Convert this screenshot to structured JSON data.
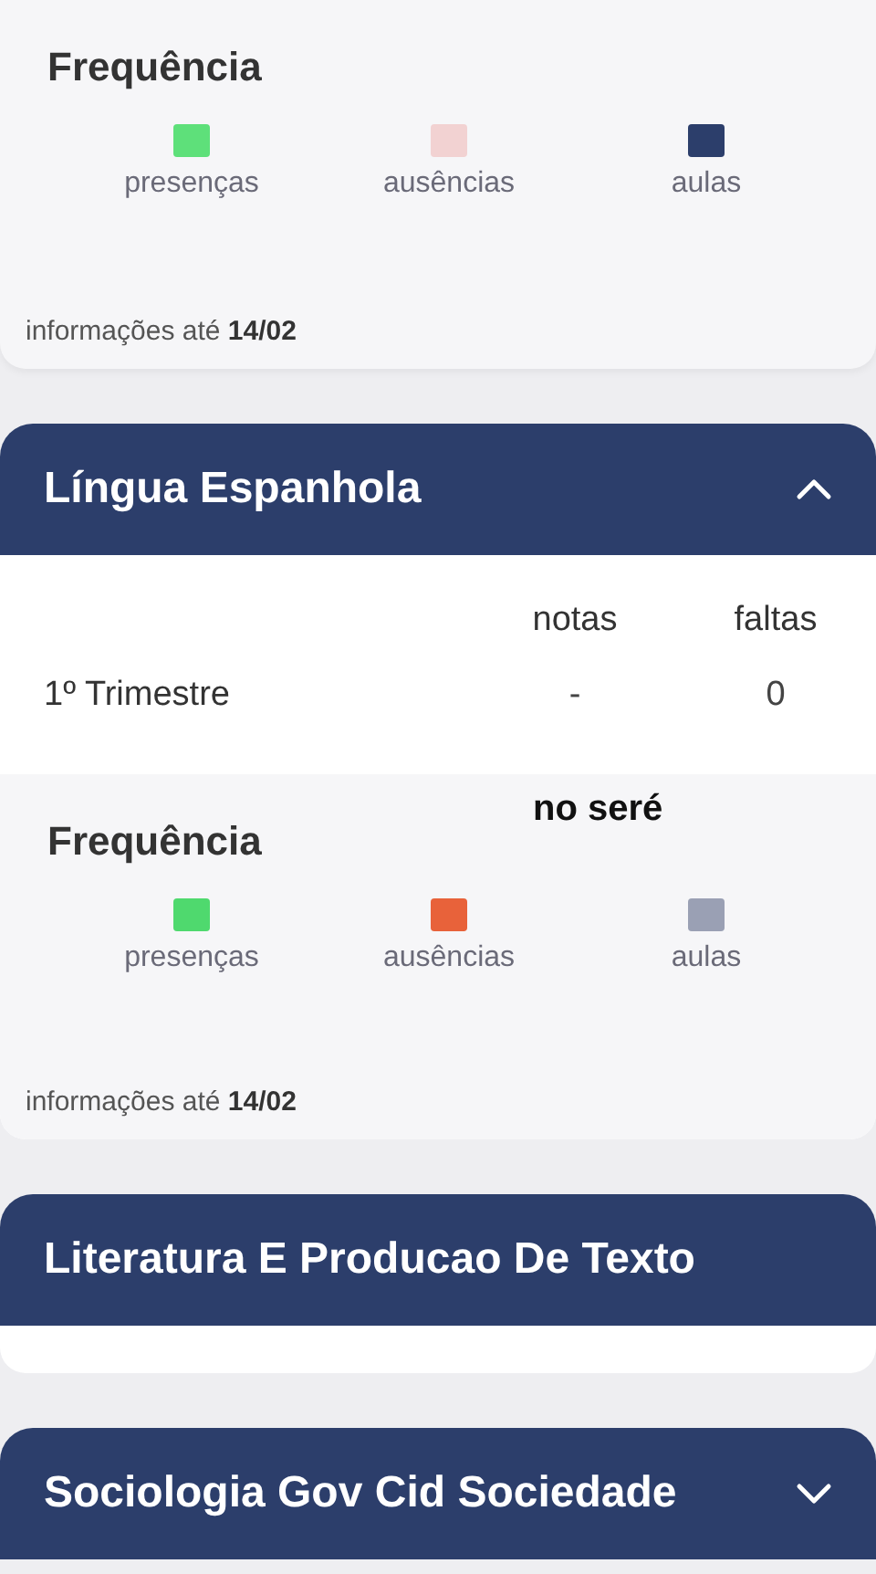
{
  "top_frequency": {
    "title": "Frequência",
    "stats": [
      {
        "label": "presenças",
        "color": "#5ee07a"
      },
      {
        "label": "ausências",
        "color": "#f2d2d2"
      },
      {
        "label": "aulas",
        "color": "#2c3e6b"
      }
    ],
    "info_prefix": "informações até",
    "info_date": "14/02"
  },
  "subjects": [
    {
      "name": "Língua Espanhola",
      "expanded": true,
      "show_chevron": true,
      "grades": {
        "columns": [
          "notas",
          "faltas"
        ],
        "rows": [
          {
            "period": "1º Trimestre",
            "cells": [
              "-",
              "0"
            ]
          }
        ]
      },
      "frequency": {
        "title": "Frequência",
        "stats": [
          {
            "label": "presenças",
            "color": "#4fd96e"
          },
          {
            "label": "ausências",
            "color": "#e8623a"
          },
          {
            "label": "aulas",
            "color": "#9aa0b4"
          }
        ],
        "info_prefix": "informações até",
        "info_date": "14/02"
      }
    },
    {
      "name": "Literatura E Producao De Texto",
      "expanded": true,
      "show_chevron": false
    },
    {
      "name": "Sociologia Gov Cid Sociedade",
      "expanded": false,
      "show_chevron": true
    }
  ],
  "overlay_caption": "no seré"
}
